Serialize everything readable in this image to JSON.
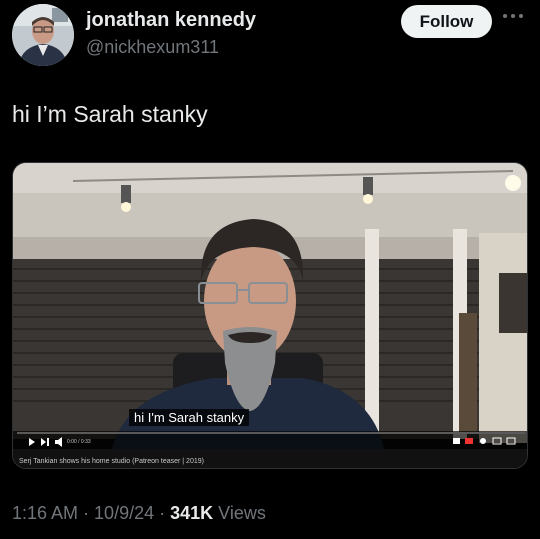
{
  "author": {
    "display_name": "jonathan kennedy",
    "handle": "@nickhexum311",
    "avatar_icon": "person-photo-icon"
  },
  "follow_label": "Follow",
  "more_icon": "more-horizontal-icon",
  "tweet": {
    "text": "hi I’m Sarah stanky"
  },
  "video": {
    "caption": "hi I'm Sarah stanky",
    "subtitle": "Serj Tankian shows his home studio (Patreon teaser | 2019)",
    "time": "0:00 / 0:33",
    "progress": 0.0
  },
  "meta": {
    "time": "1:16 AM",
    "sep1": " · ",
    "date": "10/9/24",
    "sep2": " · ",
    "views_count": "341K",
    "views_label": " Views"
  },
  "colors": {
    "background": "#000000",
    "text": "#e7e9ea",
    "muted": "#71767b",
    "follow_bg": "#eff3f4"
  }
}
